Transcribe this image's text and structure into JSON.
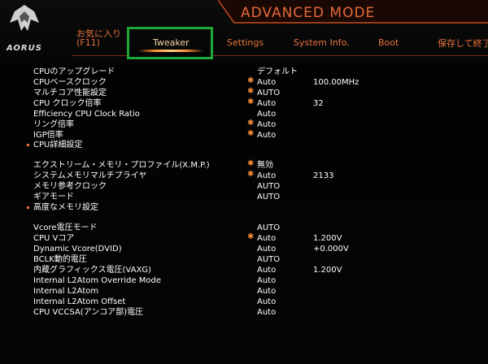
{
  "brand": {
    "name": "AORUS"
  },
  "mode": {
    "title": "ADVANCED MODE"
  },
  "tabs": {
    "favorites": {
      "line1": "お気に入り",
      "line2": "(F11)"
    },
    "tweaker": "Tweaker",
    "settings": "Settings",
    "system_info": "System Info.",
    "boot": "Boot",
    "save_exit": "保存して終了"
  },
  "colors": {
    "accent": "#e8743c",
    "highlight_box": "#1fa83a",
    "background": "#000000"
  },
  "items": [
    {
      "label": "CPUのアップグレード",
      "value": "デフォルト",
      "star": false,
      "current": ""
    },
    {
      "label": "CPUベースクロック",
      "value": "Auto",
      "star": true,
      "current": "100.00MHz"
    },
    {
      "label": "マルチコア性能設定",
      "value": "AUTO",
      "star": true,
      "current": ""
    },
    {
      "label": "CPU クロック倍率",
      "value": "Auto",
      "star": true,
      "current": "32"
    },
    {
      "label": "Efficiency CPU Clock Ratio",
      "value": "Auto",
      "star": false,
      "current": ""
    },
    {
      "label": "リング倍率",
      "value": "Auto",
      "star": true,
      "current": ""
    },
    {
      "label": "IGP倍率",
      "value": "Auto",
      "star": true,
      "current": ""
    },
    {
      "label": "CPU詳細設定",
      "value": "",
      "star": false,
      "current": "",
      "submenu": true
    },
    {
      "label": "エクストリーム・メモリ・プロファイル(X.M.P.)",
      "value": "無効",
      "star": true,
      "current": ""
    },
    {
      "label": "システムメモリマルチプライヤ",
      "value": "Auto",
      "star": true,
      "current": "2133"
    },
    {
      "label": "メモリ参考クロック",
      "value": "AUTO",
      "star": false,
      "current": ""
    },
    {
      "label": "ギアモード",
      "value": "AUTO",
      "star": false,
      "current": ""
    },
    {
      "label": "高度なメモリ設定",
      "value": "",
      "star": false,
      "current": "",
      "submenu": true
    },
    {
      "label": "Vcore電圧モード",
      "value": "AUTO",
      "star": false,
      "current": ""
    },
    {
      "label": "CPU Vコア",
      "value": "Auto",
      "star": true,
      "current": "1.200V"
    },
    {
      "label": "Dynamic Vcore(DVID)",
      "value": "Auto",
      "star": false,
      "current": "+0.000V"
    },
    {
      "label": "BCLK動的電圧",
      "value": "AUTO",
      "star": false,
      "current": ""
    },
    {
      "label": "内蔵グラフィックス電圧(VAXG)",
      "value": "Auto",
      "star": false,
      "current": "1.200V"
    },
    {
      "label": "Internal L2Atom Override Mode",
      "value": "Auto",
      "star": false,
      "current": ""
    },
    {
      "label": "Internal L2Atom",
      "value": "Auto",
      "star": false,
      "current": ""
    },
    {
      "label": "Internal L2Atom Offset",
      "value": "Auto",
      "star": false,
      "current": ""
    },
    {
      "label": "CPU VCCSA(アンコア部)電圧",
      "value": "Auto",
      "star": false,
      "current": ""
    }
  ]
}
